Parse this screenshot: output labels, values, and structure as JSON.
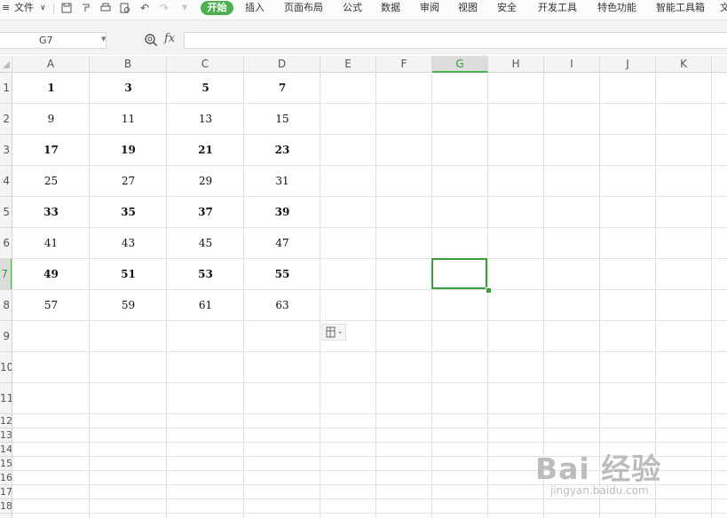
{
  "menu": {
    "file": "文件",
    "tabs": [
      "开始",
      "插入",
      "页面布局",
      "公式",
      "数据",
      "审阅",
      "视图",
      "安全",
      "开发工具",
      "特色功能",
      "智能工具箱",
      "文"
    ],
    "active_tab": "开始"
  },
  "formula_bar": {
    "name_box": "G7",
    "fx": "fx",
    "formula": ""
  },
  "columns": [
    "A",
    "B",
    "C",
    "D",
    "E",
    "F",
    "G",
    "H",
    "I",
    "J",
    "K"
  ],
  "selected_column": "G",
  "rows": [
    "1",
    "2",
    "3",
    "4",
    "5",
    "6",
    "7",
    "8",
    "9",
    "10",
    "11",
    "12",
    "13",
    "14",
    "15",
    "16",
    "17",
    "18"
  ],
  "selected_row": "7",
  "sheet_values": [
    [
      "1",
      "3",
      "5",
      "7"
    ],
    [
      "9",
      "11",
      "13",
      "15"
    ],
    [
      "17",
      "19",
      "21",
      "23"
    ],
    [
      "25",
      "27",
      "29",
      "31"
    ],
    [
      "33",
      "35",
      "37",
      "39"
    ],
    [
      "41",
      "43",
      "45",
      "47"
    ],
    [
      "49",
      "51",
      "53",
      "55"
    ],
    [
      "57",
      "59",
      "61",
      "63"
    ]
  ],
  "bold_rows": [
    1,
    3,
    5,
    7
  ],
  "active_cell": "G7",
  "watermark": {
    "text": "Bai 经验",
    "url": "jingyan.baidu.com"
  },
  "colors": {
    "accent": "#4caf50"
  }
}
